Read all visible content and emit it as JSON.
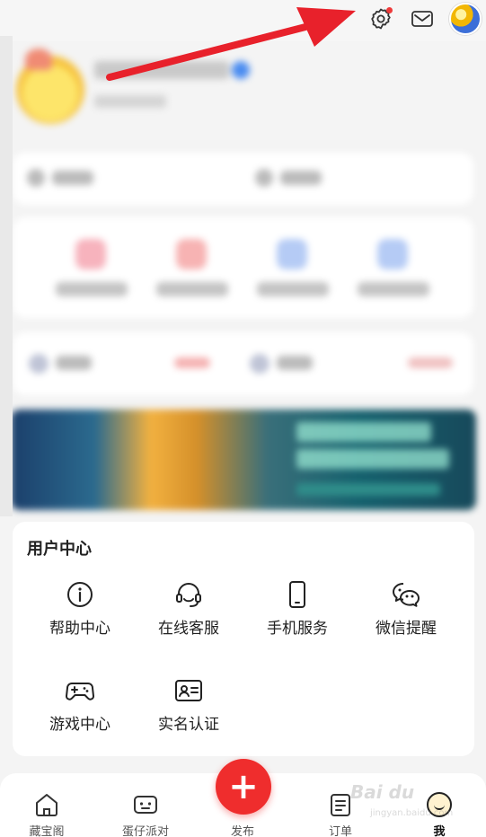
{
  "user_center": {
    "title": "用户中心",
    "items": [
      {
        "label": "帮助中心",
        "icon": "info-icon"
      },
      {
        "label": "在线客服",
        "icon": "headset-icon"
      },
      {
        "label": "手机服务",
        "icon": "phone-icon"
      },
      {
        "label": "微信提醒",
        "icon": "wechat-icon"
      },
      {
        "label": "游戏中心",
        "icon": "gamepad-icon"
      },
      {
        "label": "实名认证",
        "icon": "id-card-icon"
      }
    ]
  },
  "bottom_nav": {
    "items": [
      {
        "label": "藏宝阁",
        "icon": "home-icon"
      },
      {
        "label": "蛋仔派对",
        "icon": "game-face-icon"
      },
      {
        "label": "发布",
        "icon": "plus-icon"
      },
      {
        "label": "订单",
        "icon": "order-icon"
      },
      {
        "label": "我",
        "icon": "me-avatar-icon",
        "active": true
      }
    ]
  },
  "watermark": {
    "text": "Bai du",
    "sub": "jingyan.baidu.com"
  },
  "colors": {
    "accent": "#ef2d2d",
    "notification_dot": "#ee3a3a"
  }
}
